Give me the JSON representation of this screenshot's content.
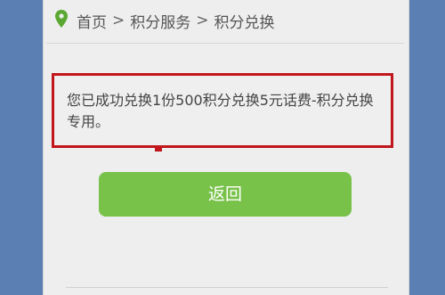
{
  "breadcrumb": {
    "items": [
      "首页",
      "积分服务",
      "积分兑换"
    ],
    "separator": ">"
  },
  "notice": {
    "message": "您已成功兑换1份500积分兑换5元话费-积分兑换专用。"
  },
  "back_button": {
    "label": "返回"
  },
  "colors": {
    "accent_green": "#78c24a",
    "highlight_red": "#c0161c",
    "pin_green": "#5aa832",
    "background_blue": "#5b7fb2"
  },
  "icons": {
    "location": "location-pin-icon"
  }
}
